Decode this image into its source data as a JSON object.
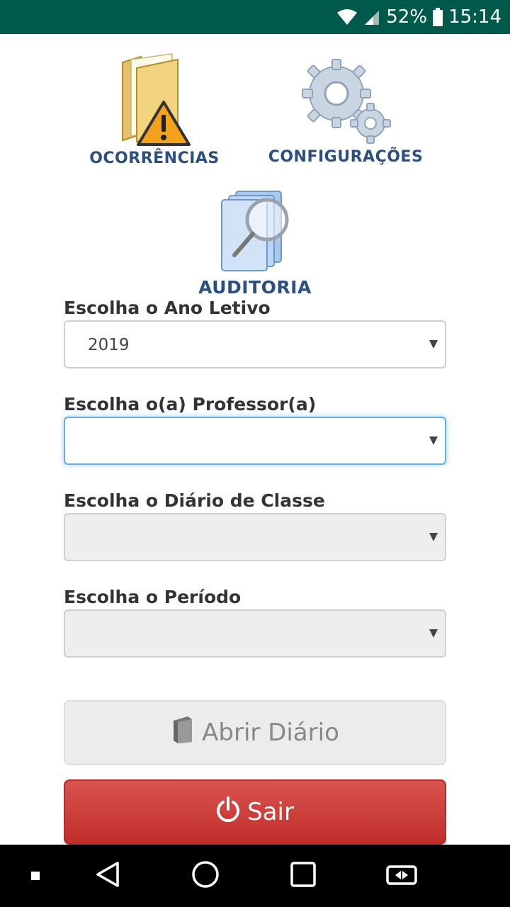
{
  "status_bar": {
    "battery_percent": "52%",
    "time": "15:14",
    "icons": [
      "wifi-icon",
      "cell-signal-icon",
      "battery-icon"
    ]
  },
  "menu": {
    "ocorrencias": "Ocorrências",
    "configuracoes": "Configurações",
    "auditoria": "Auditoria"
  },
  "form": {
    "ano_label": "Escolha o Ano Letivo",
    "ano_value": "2019",
    "professor_label": "Escolha o(a) Professor(a)",
    "professor_value": "",
    "diario_label": "Escolha o Diário de Classe",
    "diario_value": "",
    "periodo_label": "Escolha o Período",
    "periodo_value": ""
  },
  "buttons": {
    "abrir_label": "Abrir Diário",
    "sair_label": "Sair"
  },
  "colors": {
    "status_bar": "#005a4b",
    "menu_label": "#2b4f82",
    "sair_button": "#c9302c"
  }
}
